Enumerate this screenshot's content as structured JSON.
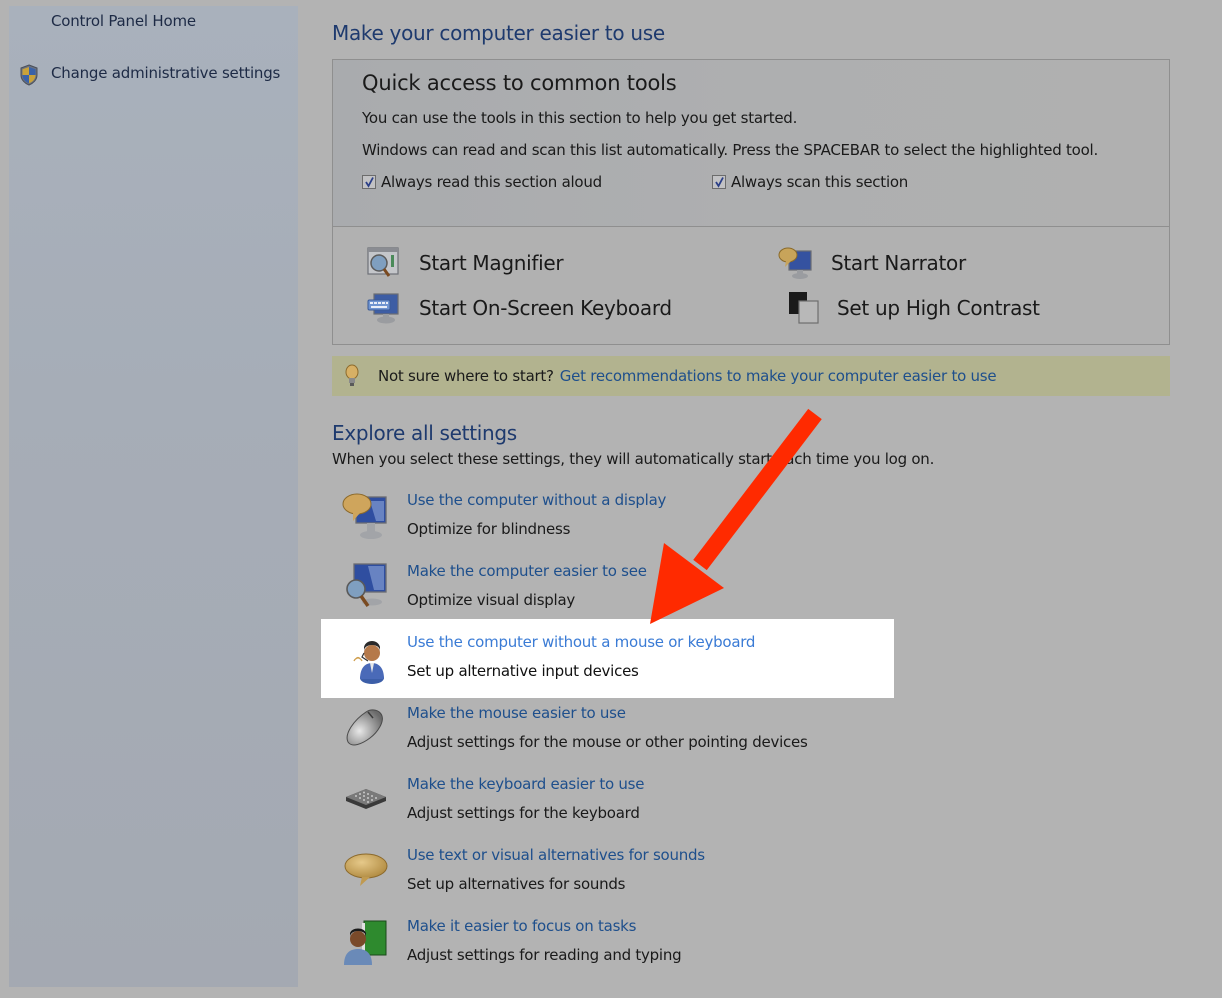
{
  "sidebar": {
    "home_label": "Control Panel Home",
    "admin_label": "Change administrative settings",
    "admin_icon": "uac-shield-icon"
  },
  "main": {
    "title": "Make your computer easier to use",
    "quick_access": {
      "title": "Quick access to common tools",
      "line1": "You can use the tools in this section to help you get started.",
      "line2": "Windows can read and scan this list automatically.  Press the SPACEBAR to select the highlighted tool.",
      "checkboxes": [
        {
          "label": "Always read this section aloud",
          "checked": true
        },
        {
          "label": "Always scan this section",
          "checked": true
        }
      ],
      "tools": [
        {
          "label": "Start Magnifier",
          "icon": "magnifier-icon"
        },
        {
          "label": "Start On-Screen Keyboard",
          "icon": "on-screen-keyboard-icon"
        },
        {
          "label": "Start Narrator",
          "icon": "narrator-icon"
        },
        {
          "label": "Set up High Contrast",
          "icon": "high-contrast-icon"
        }
      ]
    },
    "tip": {
      "icon": "lightbulb-icon",
      "label": "Not sure where to start?",
      "link": "Get recommendations to make your computer easier to use"
    },
    "explore": {
      "title": "Explore all settings",
      "subtitle": "When you select these settings, they will automatically start each time you log on.",
      "items": [
        {
          "link": "Use the computer without a display",
          "desc": "Optimize for blindness",
          "icon": "monitor-speech-icon",
          "highlighted": false
        },
        {
          "link": "Make the computer easier to see",
          "desc": "Optimize visual display",
          "icon": "monitor-magnifier-icon",
          "highlighted": false
        },
        {
          "link": "Use the computer without a mouse or keyboard",
          "desc": "Set up alternative input devices",
          "icon": "user-headset-icon",
          "highlighted": true
        },
        {
          "link": "Make the mouse easier to use",
          "desc": "Adjust settings for the mouse or other pointing devices",
          "icon": "mouse-icon",
          "highlighted": false
        },
        {
          "link": "Make the keyboard easier to use",
          "desc": "Adjust settings for the keyboard",
          "icon": "keyboard-icon",
          "highlighted": false
        },
        {
          "link": "Use text or visual alternatives for sounds",
          "desc": "Set up alternatives for sounds",
          "icon": "speech-bubble-icon",
          "highlighted": false
        },
        {
          "link": "Make it easier to focus on tasks",
          "desc": "Adjust settings for reading and typing",
          "icon": "user-book-icon",
          "highlighted": false
        }
      ]
    }
  },
  "annotation": {
    "type": "arrow",
    "color": "#ff2a00",
    "points_to": "Use the computer without a mouse or keyboard"
  }
}
